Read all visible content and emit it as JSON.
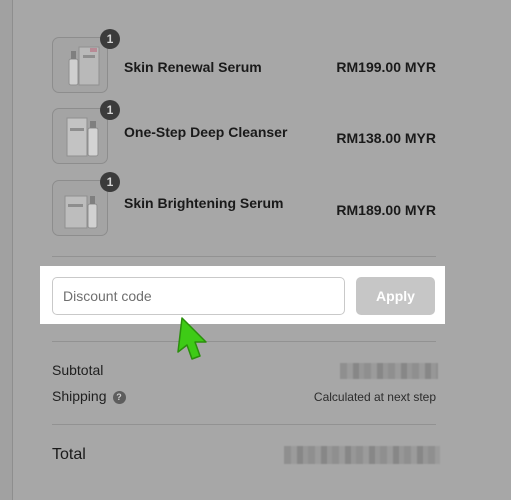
{
  "cart": {
    "items": [
      {
        "name": "Skin Renewal Serum",
        "price": "RM199.00 MYR",
        "quantity": "1",
        "image_icon": "serum-bottle-box-icon"
      },
      {
        "name": "One-Step Deep Cleanser",
        "price": "RM138.00 MYR",
        "quantity": "1",
        "image_icon": "cleanser-bottle-box-icon"
      },
      {
        "name": "Skin Brightening Serum",
        "price": "RM189.00 MYR",
        "quantity": "1",
        "image_icon": "serum-bottle-box-icon"
      }
    ]
  },
  "discount": {
    "placeholder": "Discount code",
    "value": "",
    "apply_label": "Apply"
  },
  "summary": {
    "subtotal_label": "Subtotal",
    "subtotal_value_state": "pixelated",
    "shipping_label": "Shipping",
    "shipping_help_icon": "question-icon",
    "shipping_value": "Calculated at next step",
    "total_label": "Total",
    "total_value_state": "pixelated"
  },
  "colors": {
    "overlay": "#a7a7a7",
    "highlight_panel": "#ffffff",
    "apply_button": "#c6c6c6",
    "pointer_arrow": "#3ecb16",
    "quantity_badge": "#3b3b3b"
  },
  "annotation": {
    "pointer_icon": "arrow-pointer-icon"
  }
}
